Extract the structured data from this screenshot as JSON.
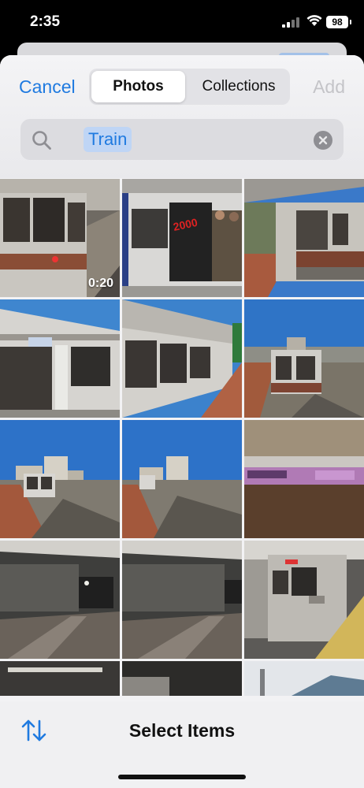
{
  "status_bar": {
    "time": "2:35",
    "battery": "98"
  },
  "header": {
    "cancel_label": "Cancel",
    "tabs": [
      {
        "label": "Photos",
        "selected": true
      },
      {
        "label": "Collections",
        "selected": false
      }
    ],
    "add_label": "Add"
  },
  "search": {
    "token": "Train"
  },
  "grid": {
    "video_duration": "0:20"
  },
  "bottom_bar": {
    "title": "Select Items"
  },
  "colors": {
    "accent": "#1f7ae0",
    "sheet": "#f2f2f4"
  }
}
